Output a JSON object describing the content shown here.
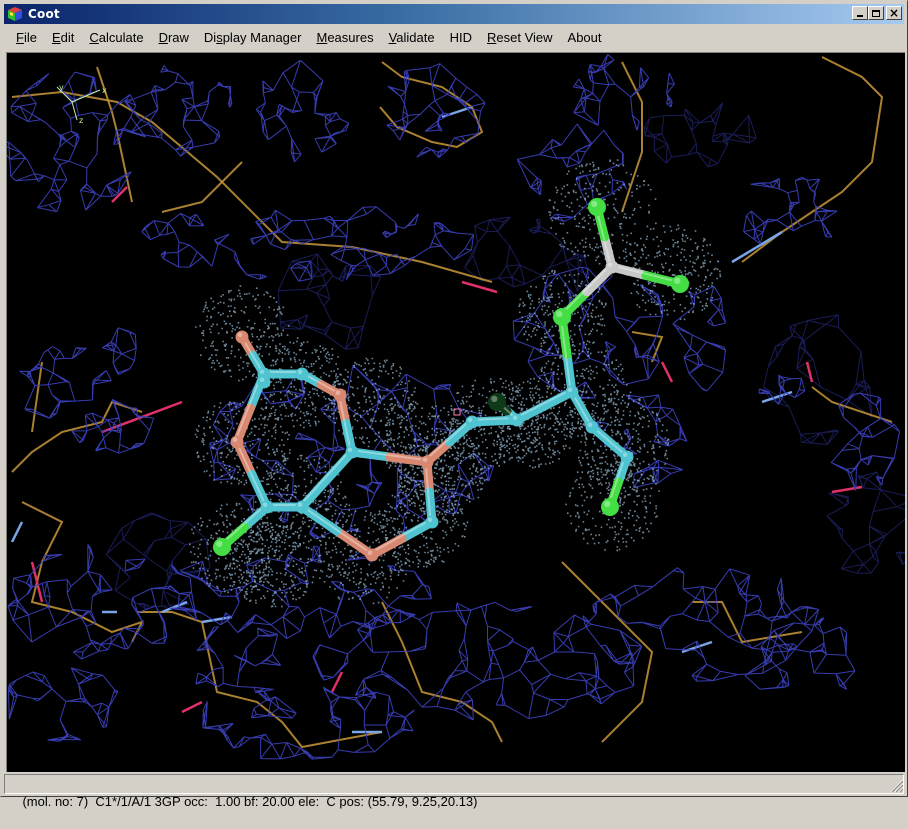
{
  "window": {
    "title": "Coot",
    "controls": {
      "minimize": "_",
      "maximize": "□",
      "close": "×"
    }
  },
  "menu": {
    "items": [
      {
        "label": "File",
        "mnemonic": "F",
        "rest": "ile"
      },
      {
        "label": "Edit",
        "mnemonic": "E",
        "rest": "dit"
      },
      {
        "label": "Calculate",
        "mnemonic": "C",
        "rest": "alculate"
      },
      {
        "label": "Draw",
        "mnemonic": "D",
        "rest": "raw"
      },
      {
        "label": "Display Manager",
        "mnemonic": "",
        "pre": "Di",
        "mid": "s",
        "rest": "play Manager"
      },
      {
        "label": "Measures",
        "mnemonic": "M",
        "rest": "easures"
      },
      {
        "label": "Validate",
        "mnemonic": "V",
        "rest": "alidate"
      },
      {
        "label": "HID",
        "mnemonic": "",
        "rest": "HID"
      },
      {
        "label": "Reset View",
        "mnemonic": "R",
        "rest": "eset View"
      },
      {
        "label": "About",
        "mnemonic": "",
        "rest": "About"
      }
    ]
  },
  "viewport": {
    "description": "3D molecular graphics view: electron density mesh around ligand 3GP with dotted surface",
    "axes_labels": [
      "x",
      "y",
      "z"
    ],
    "colors": {
      "background": "#000000",
      "density_mesh": "#3a3fb8",
      "density_mesh_far": "#1c1f5e",
      "carbon_bond_protein": "#c8973a",
      "nitrogen_bond": "#7aa6e8",
      "oxygen_bond": "#e0306a",
      "ligand_carbon": "#4fc3cf",
      "ligand_nitrogen": "#d88870",
      "ligand_oxygen": "#44dd44",
      "ligand_phosphorus": "#c8c8c8",
      "dot_surface": "#8fb0c8"
    }
  },
  "status": {
    "text": "(mol. no: 7)  C1*/1/A/1 3GP occ:  1.00 bf: 20.00 ele:  C pos: (55.79, 9.25,20.13)",
    "mol_no": 7,
    "atom_spec": "C1*/1/A/1",
    "residue": "3GP",
    "occupancy": "1.00",
    "b_factor": "20.00",
    "element": "C",
    "position": [
      55.79,
      9.25,
      20.13
    ]
  }
}
